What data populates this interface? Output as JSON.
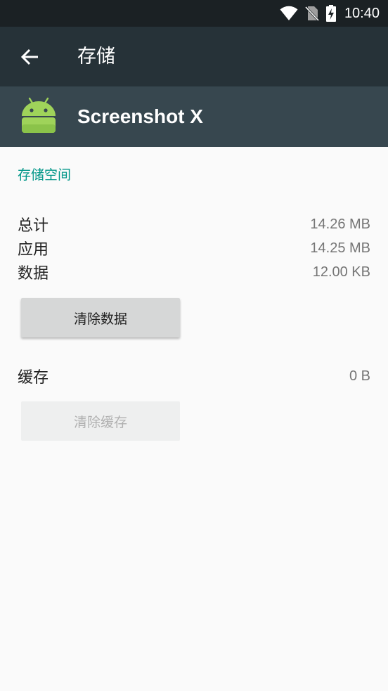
{
  "status_bar": {
    "time": "10:40",
    "icons": [
      "wifi-icon",
      "no-sim-icon",
      "battery-charging-icon"
    ]
  },
  "toolbar": {
    "back_icon": "arrow-back-icon",
    "title": "存储"
  },
  "app": {
    "icon": "android-icon",
    "name": "Screenshot X"
  },
  "storage": {
    "section_title": "存储空间",
    "total_label": "总计",
    "total_value": "14.26 MB",
    "app_label": "应用",
    "app_value": "14.25 MB",
    "data_label": "数据",
    "data_value": "12.00 KB",
    "clear_data_label": "清除数据"
  },
  "cache": {
    "label": "缓存",
    "value": "0 B",
    "clear_cache_label": "清除缓存"
  },
  "colors": {
    "status_bar": "#1b2124",
    "toolbar": "#263238",
    "app_header": "#37474f",
    "accent": "#009688",
    "android_green": "#9fd35a"
  }
}
